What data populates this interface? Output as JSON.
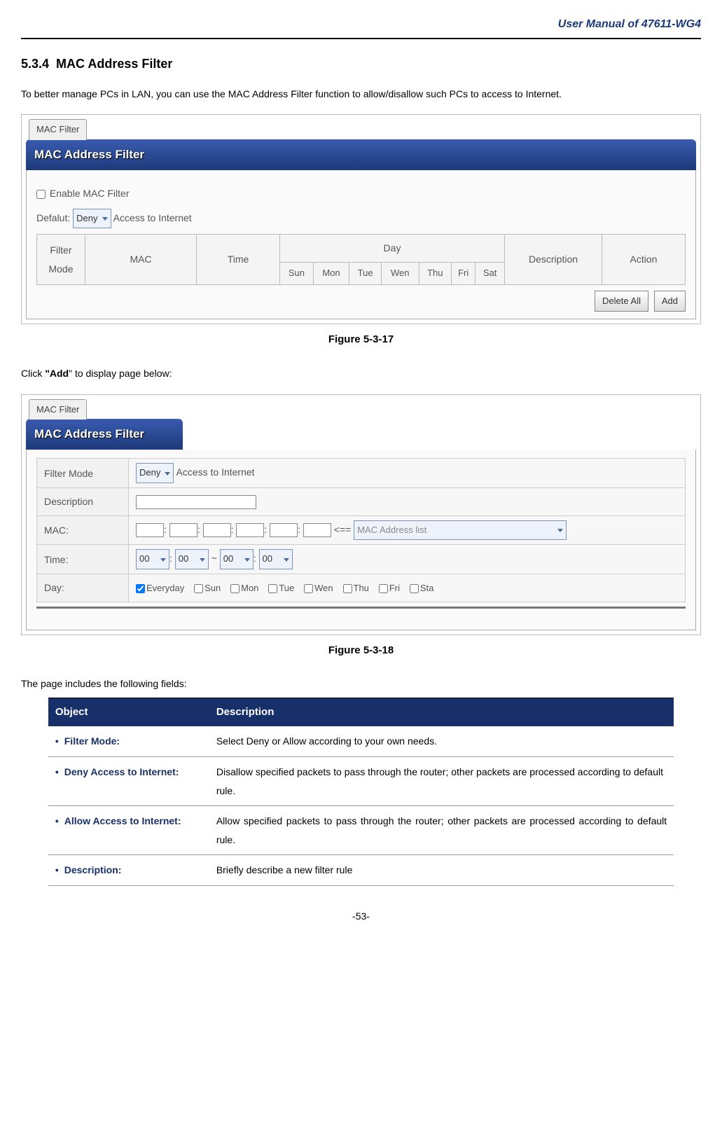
{
  "header": {
    "title": "User Manual of 47611-WG4"
  },
  "section": {
    "number": "5.3.4",
    "title": "MAC Address Filter"
  },
  "intro": "To better manage PCs in LAN, you can use the MAC Address Filter function to allow/disallow such PCs to access to Internet.",
  "shot1": {
    "tab": "MAC Filter",
    "title": "MAC Address Filter",
    "enable_label": "Enable MAC Filter",
    "default_label": "Defalut:",
    "default_value": "Deny",
    "default_suffix": "Access to Internet",
    "cols": {
      "filter_mode": "Filter\nMode",
      "mac": "MAC",
      "time": "Time",
      "day": "Day",
      "days": [
        "Sun",
        "Mon",
        "Tue",
        "Wen",
        "Thu",
        "Fri",
        "Sat"
      ],
      "description": "Description",
      "action": "Action"
    },
    "buttons": {
      "delete_all": "Delete All",
      "add": "Add"
    }
  },
  "fig1": "Figure 5-3-17",
  "click_add_prefix": "Click ",
  "click_add_bold": "\"Add",
  "click_add_suffix": "\" to display page below:",
  "shot2": {
    "tab": "MAC Filter",
    "title": "MAC Address Filter",
    "rows": {
      "filter_mode_label": "Filter Mode",
      "filter_mode_value": "Deny",
      "filter_mode_suffix": "Access to Internet",
      "description_label": "Description",
      "mac_label": "MAC:",
      "mac_arrow": "<==",
      "mac_list_placeholder": "MAC Address list",
      "time_label": "Time:",
      "t1": "00",
      "t2": "00",
      "t3": "00",
      "t4": "00",
      "day_label": "Day:",
      "days": [
        "Everyday",
        "Sun",
        "Mon",
        "Tue",
        "Wen",
        "Thu",
        "Fri",
        "Sta"
      ]
    }
  },
  "fig2": "Figure 5-3-18",
  "fields_intro": "The page includes the following fields:",
  "table": {
    "headers": {
      "object": "Object",
      "description": "Description"
    },
    "rows": [
      {
        "obj": "Filter Mode:",
        "desc": "Select Deny or Allow according to your own needs."
      },
      {
        "obj": "Deny Access to Internet:",
        "desc": "Disallow specified packets to pass through the router; other packets are processed according to default rule."
      },
      {
        "obj": "Allow Access to Internet:",
        "desc": "Allow specified packets to pass through the router; other packets are processed according to default rule."
      },
      {
        "obj": "Description:",
        "desc": "Briefly describe a new filter rule"
      }
    ]
  },
  "page_number": "-53-"
}
